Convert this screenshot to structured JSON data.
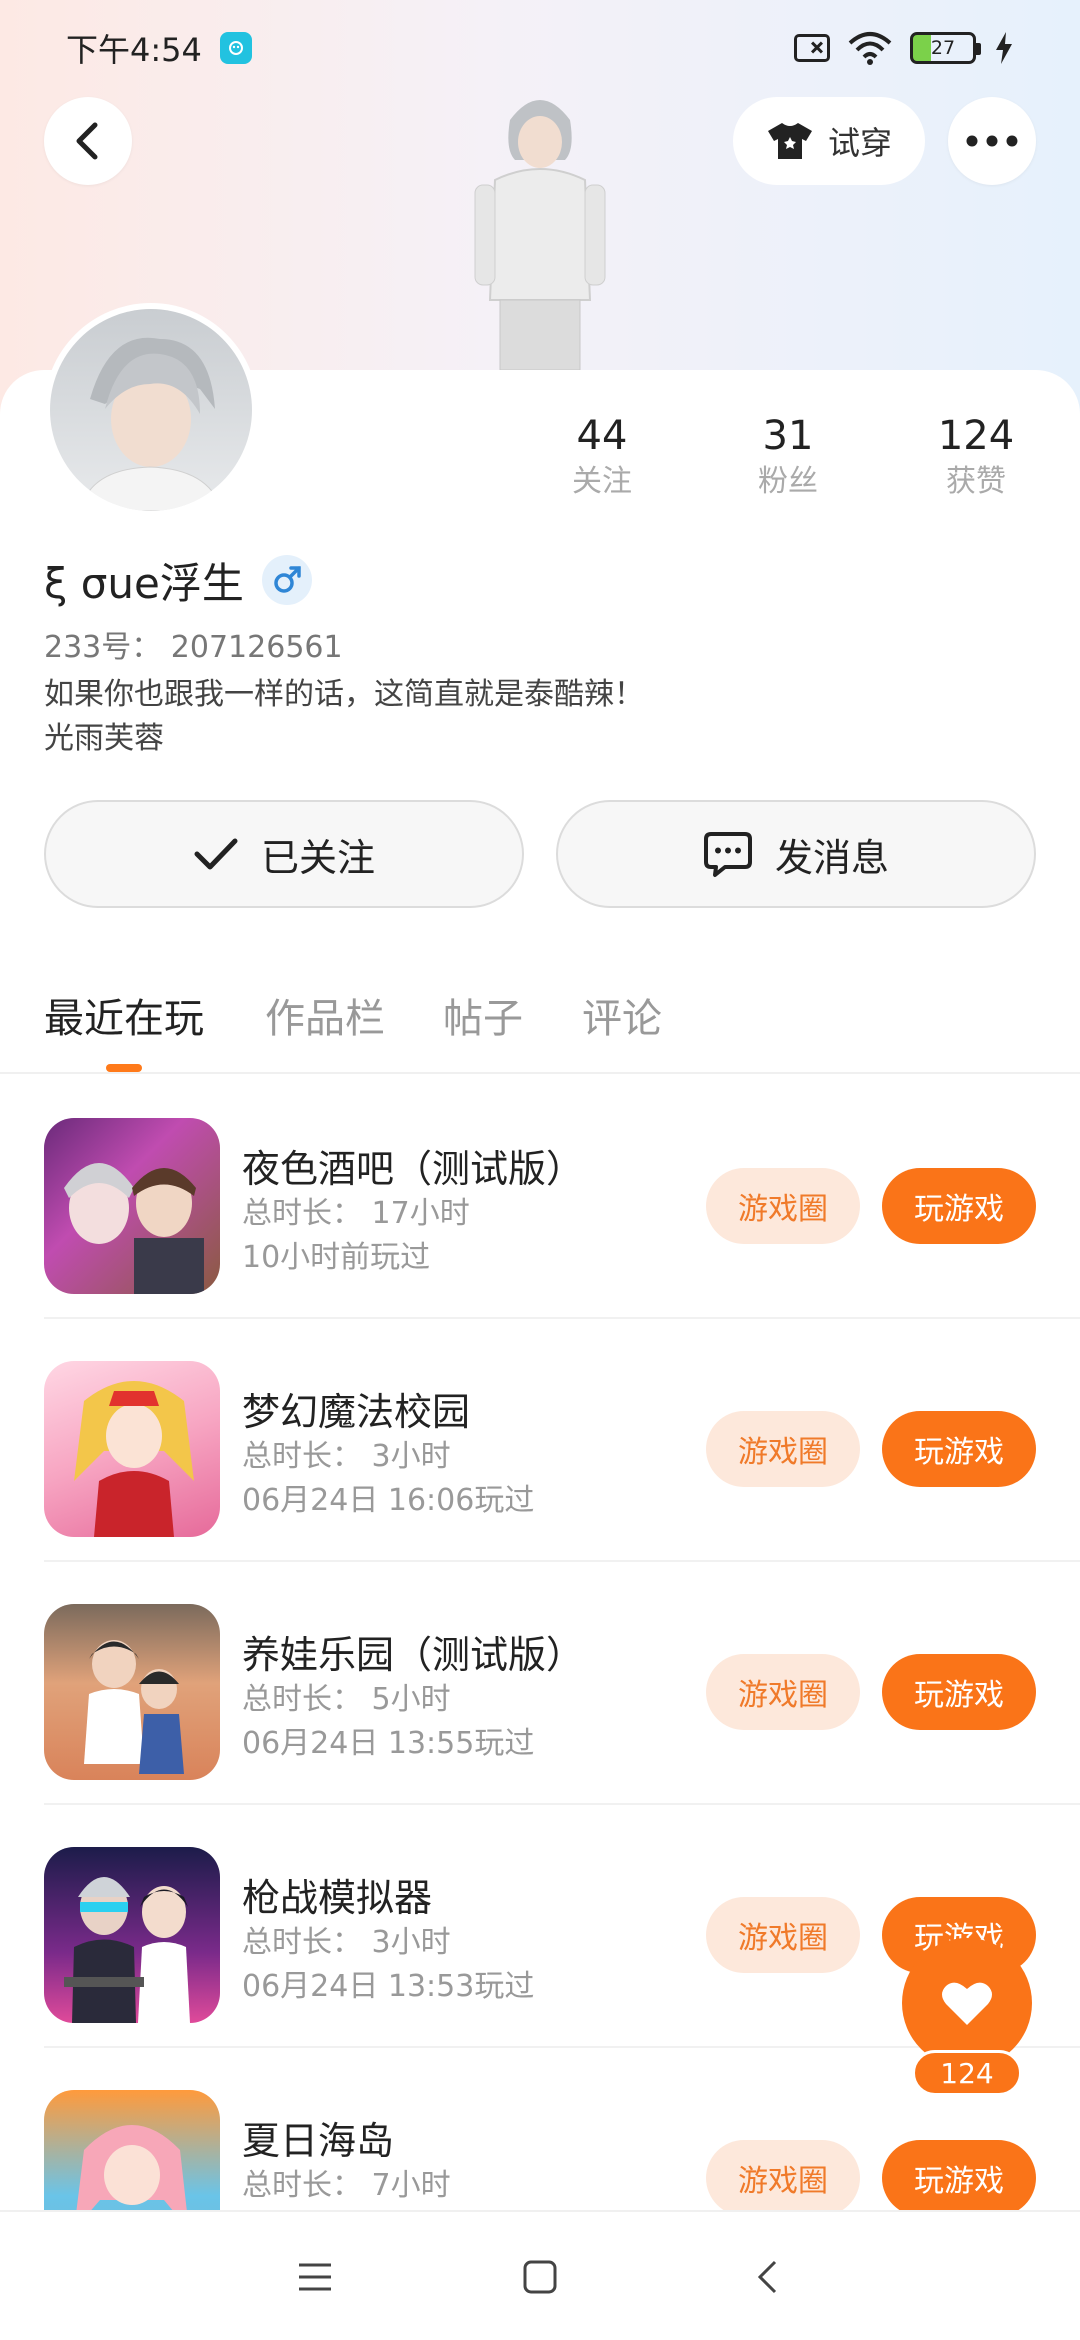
{
  "status_bar": {
    "time": "下午4:54",
    "battery": "27",
    "icons": [
      "app-notification-icon",
      "sim-off-icon",
      "wifi-icon",
      "battery-icon",
      "charging-icon"
    ]
  },
  "header": {
    "try_on_label": "试穿",
    "icons": [
      "back-arrow-icon",
      "tshirt-icon",
      "more-dots-icon"
    ]
  },
  "profile": {
    "username": "ξ σue浮生",
    "gender_icon": "male-icon",
    "uid": "233号：  207126561",
    "bio_line1": "如果你也跟我一样的话，这简直就是泰酷辣！",
    "bio_line2": "光雨芙蓉",
    "stats": [
      {
        "value": "44",
        "label": "关注"
      },
      {
        "value": "31",
        "label": "粉丝"
      },
      {
        "value": "124",
        "label": "获赞"
      }
    ]
  },
  "actions": {
    "follow_label": "已关注",
    "message_label": "发消息"
  },
  "tabs": [
    {
      "label": "最近在玩",
      "active": true
    },
    {
      "label": "作品栏",
      "active": false
    },
    {
      "label": "帖子",
      "active": false
    },
    {
      "label": "评论",
      "active": false
    }
  ],
  "games": [
    {
      "title": "夜色酒吧（测试版）",
      "duration": "总时长：  17小时",
      "last_played": "10小时前玩过",
      "circle_label": "游戏圈",
      "play_label": "玩游戏"
    },
    {
      "title": "梦幻魔法校园",
      "duration": "总时长：  3小时",
      "last_played": "06月24日 16:06玩过",
      "circle_label": "游戏圈",
      "play_label": "玩游戏"
    },
    {
      "title": "养娃乐园（测试版）",
      "duration": "总时长：  5小时",
      "last_played": "06月24日 13:55玩过",
      "circle_label": "游戏圈",
      "play_label": "玩游戏"
    },
    {
      "title": "枪战模拟器",
      "duration": "总时长：  3小时",
      "last_played": "06月24日 13:53玩过",
      "circle_label": "游戏圈",
      "play_label": "玩游戏"
    },
    {
      "title": "夏日海岛",
      "duration": "总时长：  7小时",
      "last_played": "",
      "circle_label": "游戏圈",
      "play_label": "玩游戏"
    }
  ],
  "like_fab": {
    "count": "124",
    "icon": "heart-icon"
  },
  "nav_bar": {
    "icons": [
      "menu-icon",
      "home-square-icon",
      "back-chevron-icon"
    ]
  },
  "colors": {
    "accent": "#fa7418",
    "accent_light": "#fde8db",
    "text_gray": "#999999"
  }
}
